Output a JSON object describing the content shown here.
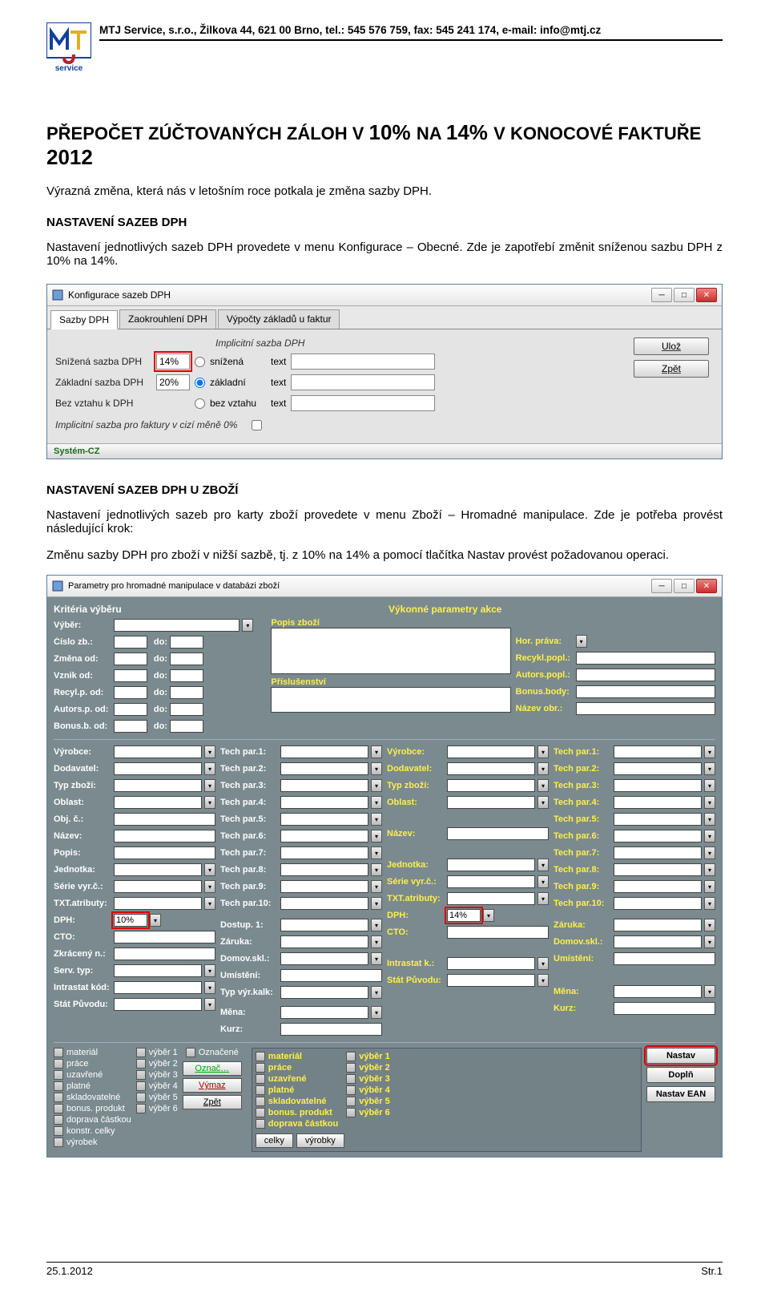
{
  "header": {
    "company_line": "MTJ Service, s.r.o., Žilkova 44, 621 00 Brno, tel.: 545 576 759, fax: 545 241 174, e-mail: info@mtj.cz"
  },
  "title": {
    "p1": "PŘEPOČET ZÚČTOVANÝCH ZÁLOH V ",
    "pct_a": "10% ",
    "mid": "NA ",
    "pct_b": "14% ",
    "p2": "V KONOCOVÉ FAKTUŘE ",
    "year": "2012"
  },
  "intro": "Výrazná změna, která nás v letošním roce potkala je změna sazby DPH.",
  "s1": {
    "head": "NASTAVENÍ SAZEB DPH",
    "body": "Nastavení jednotlivých sazeb DPH provedete v menu Konfigurace – Obecné. Zde je zapotřebí změnit sníženou sazbu DPH z 10% na 14%."
  },
  "win1": {
    "title": "Konfigurace sazeb DPH",
    "tabs": [
      "Sazby DPH",
      "Zaokrouhlení DPH",
      "Výpočty základů u faktur"
    ],
    "section_label": "Implicitní sazba DPH",
    "rows": {
      "r1": {
        "label": "Snížená sazba DPH",
        "value": "14%",
        "radio": "snížená",
        "text_label": "text"
      },
      "r2": {
        "label": "Základní sazba DPH",
        "value": "20%",
        "radio": "základní",
        "text_label": "text"
      },
      "r3": {
        "label": "Bez vztahu k DPH",
        "value": "",
        "radio": "bez vztahu",
        "text_label": "text"
      }
    },
    "implicit_fx": "Implicitní sazba pro faktury v cizí měně 0%",
    "btn_save": "Ulož",
    "btn_back": "Zpět",
    "status": "Systém-CZ"
  },
  "s2": {
    "head": "NASTAVENÍ SAZEB DPH U ZBOŽÍ",
    "body": "Nastavení jednotlivých sazeb pro karty zboží provedete v menu Zboží – Hromadné manipulace. Zde je potřeba provést následující krok:",
    "body2": "Změnu sazby DPH pro zboží v nižší sazbě, tj. z 10% na 14% a pomocí tlačítka Nastav provést požadovanou operaci."
  },
  "win2": {
    "title": "Parametry pro hromadné manipulace v databázi zboží",
    "left_head": "Kritéria výběru",
    "right_head": "Výkonné parametry akce",
    "popis": "Popis zboží",
    "prislus": "Příslušenství",
    "labels": {
      "vyber": "Výběr:",
      "cislo_zb": "Číslo zb.:",
      "do": "do:",
      "zmena_od": "Změna od:",
      "vznik_od": "Vznik od:",
      "recylp_od": "Recyl.p. od:",
      "autors_od": "Autors.p. od:",
      "bonusb_od": "Bonus.b. od:",
      "vyrobce": "Výrobce:",
      "dodavatel": "Dodavatel:",
      "typ_zbozi": "Typ zboží:",
      "oblast": "Oblast:",
      "obj_c": "Obj. č.:",
      "nazev": "Název:",
      "popis_l": "Popis:",
      "jednotka": "Jednotka:",
      "serie_vyrc": "Série vyr.č.:",
      "txt_atrib": "TXT.atributy:",
      "dph": "DPH:",
      "cto": "CTO:",
      "zkraceny_n": "Zkrácený n.:",
      "serv_typ": "Serv. typ:",
      "intrastat_kod": "Intrastat kód:",
      "stat_puvodu": "Stát Původu:",
      "techpar": "Tech par.",
      "dostup1": "Dostup. 1:",
      "zaruka": "Záruka:",
      "domovskl": "Domov.skl.:",
      "umisteni": "Umístění:",
      "typ_vyr_kalk": "Typ výr.kalk:",
      "mena": "Měna:",
      "kurz": "Kurz:",
      "hor_prava": "Hor. práva:",
      "recykl_popl": "Recykl.popl.:",
      "autors_popl": "Autors.popl.:",
      "bonus_body": "Bonus.body:",
      "nazev_obr": "Název obr.:",
      "intrastat_k": "Intrastat k.:",
      "stat_puvodu_r": "Stát Původu:"
    },
    "dph_left_value": "10%",
    "dph_right_value": "14%",
    "checks_left": [
      "materiál",
      "práce",
      "uzavřené",
      "platné",
      "skladovatelné",
      "bonus. produkt",
      "doprava částkou",
      "konstr. celky",
      "výrobek"
    ],
    "checks_vyber_left": [
      "výběr 1",
      "výběr 2",
      "výběr 3",
      "výběr 4",
      "výběr 5",
      "výběr 6"
    ],
    "oznacene_label": "Označené",
    "btn_oznac": "Označ…",
    "btn_vymaz": "Výmaz",
    "btn_zpet": "Zpět",
    "checks_mid": [
      "materiál",
      "práce",
      "uzavřené",
      "platné",
      "skladovatelné",
      "bonus. produkt",
      "doprava částkou"
    ],
    "checks_vyber_mid": [
      "výběr 1",
      "výběr 2",
      "výběr 3",
      "výběr 4",
      "výběr 5",
      "výběr 6"
    ],
    "btn_celky": "celky",
    "btn_vyrobky": "výrobky",
    "btn_nastav": "Nastav",
    "btn_dopln": "Doplň",
    "btn_nastav_ean": "Nastav EAN"
  },
  "footer": {
    "date": "25.1.2012",
    "page": "Str.1"
  }
}
